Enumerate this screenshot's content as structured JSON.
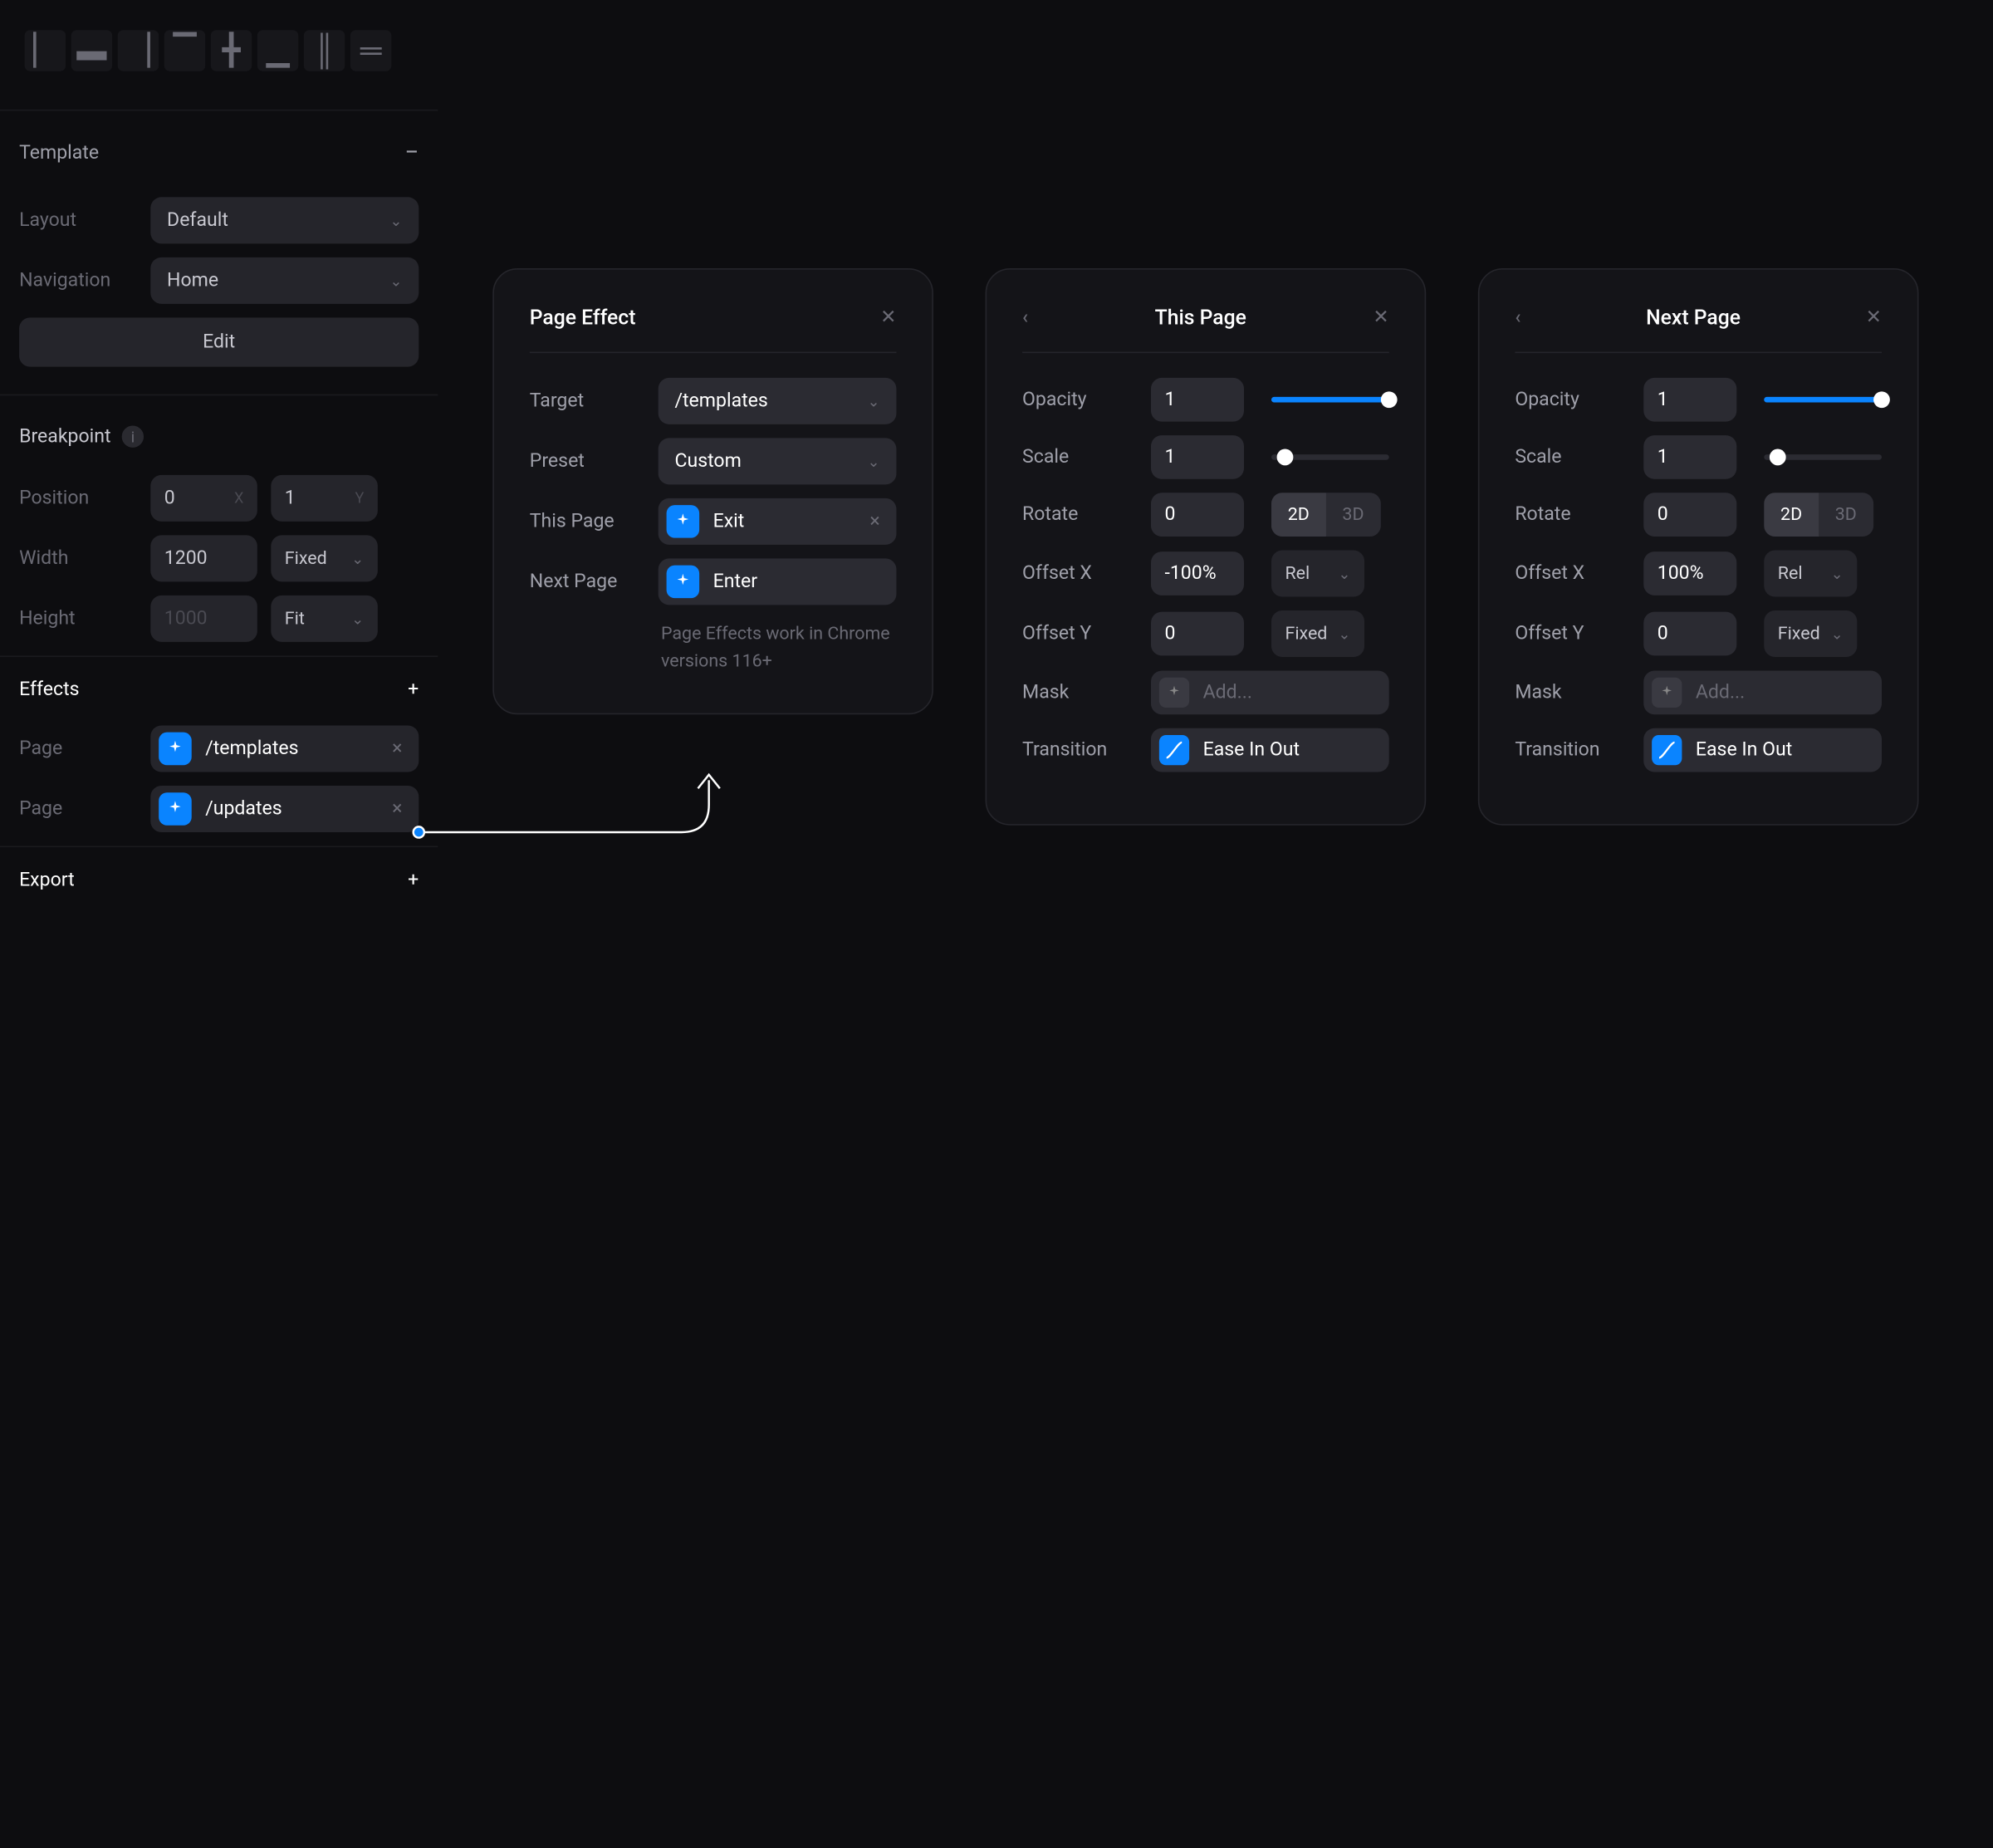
{
  "sidebar": {
    "template": {
      "title": "Template",
      "layout_label": "Layout",
      "layout_value": "Default",
      "nav_label": "Navigation",
      "nav_value": "Home",
      "edit": "Edit"
    },
    "breakpoint": {
      "title": "Breakpoint",
      "position_label": "Position",
      "pos_x": "0",
      "pos_y": "1",
      "width_label": "Width",
      "width": "1200",
      "width_unit": "Fixed",
      "height_label": "Height",
      "height_ph": "1000",
      "height_unit": "Fit"
    },
    "effects": {
      "title": "Effects",
      "page_label": "Page",
      "chip1": "/templates",
      "chip2": "/updates"
    },
    "export": {
      "title": "Export"
    }
  },
  "pageEffect": {
    "title": "Page Effect",
    "target_label": "Target",
    "target_value": "/templates",
    "preset_label": "Preset",
    "preset_value": "Custom",
    "this_label": "This Page",
    "this_value": "Exit",
    "next_label": "Next Page",
    "next_value": "Enter",
    "hint": "Page Effects work in Chrome versions 116+"
  },
  "thisPage": {
    "title": "This Page",
    "opacity_label": "Opacity",
    "opacity": "1",
    "scale_label": "Scale",
    "scale": "1",
    "rotate_label": "Rotate",
    "rotate": "0",
    "seg_2d": "2D",
    "seg_3d": "3D",
    "seg_active": "2D",
    "offx_label": "Offset X",
    "offx": "-100%",
    "offx_unit": "Rel",
    "offy_label": "Offset Y",
    "offy": "0",
    "offy_unit": "Fixed",
    "mask_label": "Mask",
    "mask_ph": "Add...",
    "trans_label": "Transition",
    "trans_value": "Ease In Out"
  },
  "nextPage": {
    "title": "Next Page",
    "opacity_label": "Opacity",
    "opacity": "1",
    "scale_label": "Scale",
    "scale": "1",
    "rotate_label": "Rotate",
    "rotate": "0",
    "seg_2d": "2D",
    "seg_3d": "3D",
    "seg_active": "2D",
    "offx_label": "Offset X",
    "offx": "100%",
    "offx_unit": "Rel",
    "offy_label": "Offset Y",
    "offy": "0",
    "offy_unit": "Fixed",
    "mask_label": "Mask",
    "mask_ph": "Add...",
    "trans_label": "Transition",
    "trans_value": "Ease In Out"
  }
}
